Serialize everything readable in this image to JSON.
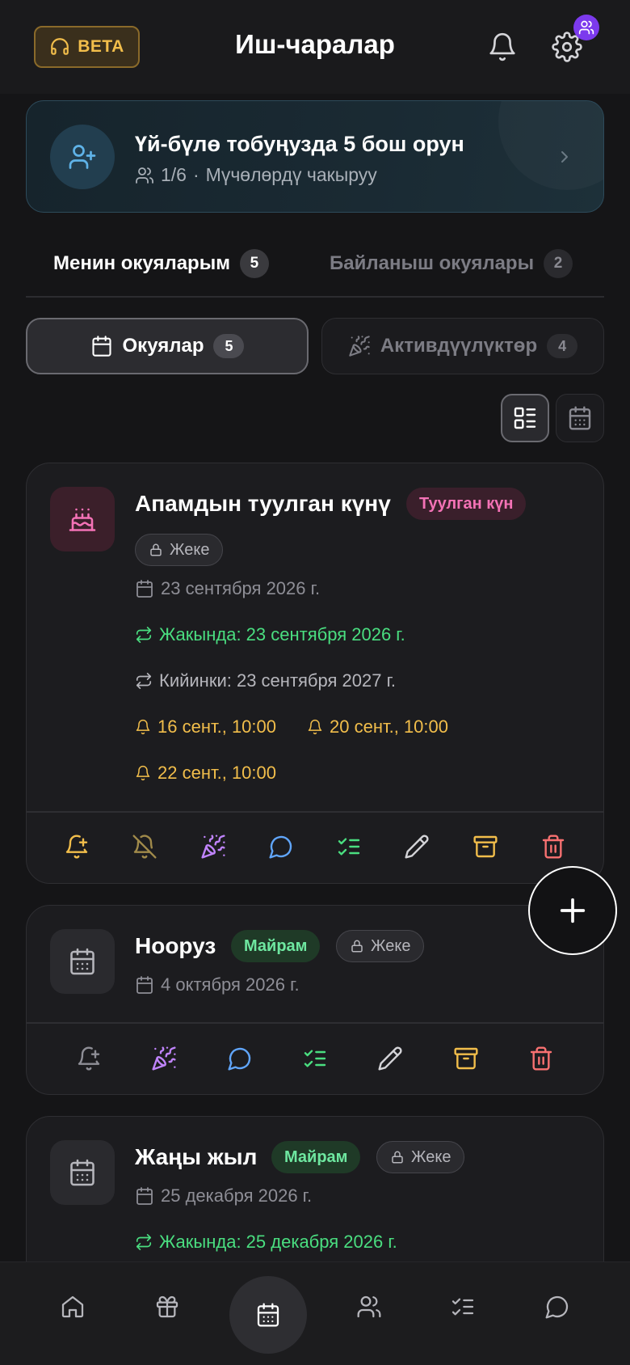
{
  "header": {
    "beta_label": "BETA",
    "title": "Иш-чаралар"
  },
  "family_banner": {
    "title": "Үй-бүлө тобуңузда 5 бош орун",
    "members": "1/6",
    "separator": "·",
    "invite_text": "Мүчөлөрдү чакыруу"
  },
  "tabs": [
    {
      "label": "Менин окуяларым",
      "count": "5"
    },
    {
      "label": "Байланыш окуялары",
      "count": "2"
    }
  ],
  "segments": [
    {
      "label": "Окуялар",
      "count": "5"
    },
    {
      "label": "Активдүүлүктөр",
      "count": "4"
    }
  ],
  "cards": [
    {
      "title": "Апамдын туулган күнү",
      "category": "Туулган күн",
      "privacy": "Жеке",
      "date": "23 сентября 2026 г.",
      "upcoming": "Жакында: 23 сентября 2026 г.",
      "next": "Кийинки: 23 сентября 2027 г.",
      "reminders": [
        "16 сент., 10:00",
        "20 сент., 10:00",
        "22 сент., 10:00"
      ]
    },
    {
      "title": "Нооруз",
      "category": "Майрам",
      "privacy": "Жеке",
      "date": "4 октября 2026 г."
    },
    {
      "title": "Жаңы жыл",
      "category": "Майрам",
      "privacy": "Жеке",
      "date": "25 декабря 2026 г.",
      "upcoming": "Жакында: 25 декабря 2026 г."
    }
  ],
  "colors": {
    "accent_gold": "#f2be4b",
    "upcoming_green": "#4ade80",
    "birthday_pink": "#f472b6",
    "holiday_green": "#6ee7a0",
    "delete_red": "#f87171",
    "comment_blue": "#60a5fa",
    "celebrate_purple": "#c084fc",
    "avatar_purple": "#7c3aed"
  },
  "icons": {
    "header": [
      "headset-icon",
      "bell-icon",
      "gear-icon",
      "users-icon"
    ],
    "card_actions": [
      "bell-plus-icon",
      "bell-off-icon",
      "party-popper-icon",
      "comment-icon",
      "checklist-icon",
      "pencil-icon",
      "archive-icon",
      "trash-icon"
    ],
    "bottom_nav": [
      "home-icon",
      "gift-icon",
      "calendar-icon",
      "users-icon",
      "checklist-icon",
      "chat-icon"
    ]
  }
}
